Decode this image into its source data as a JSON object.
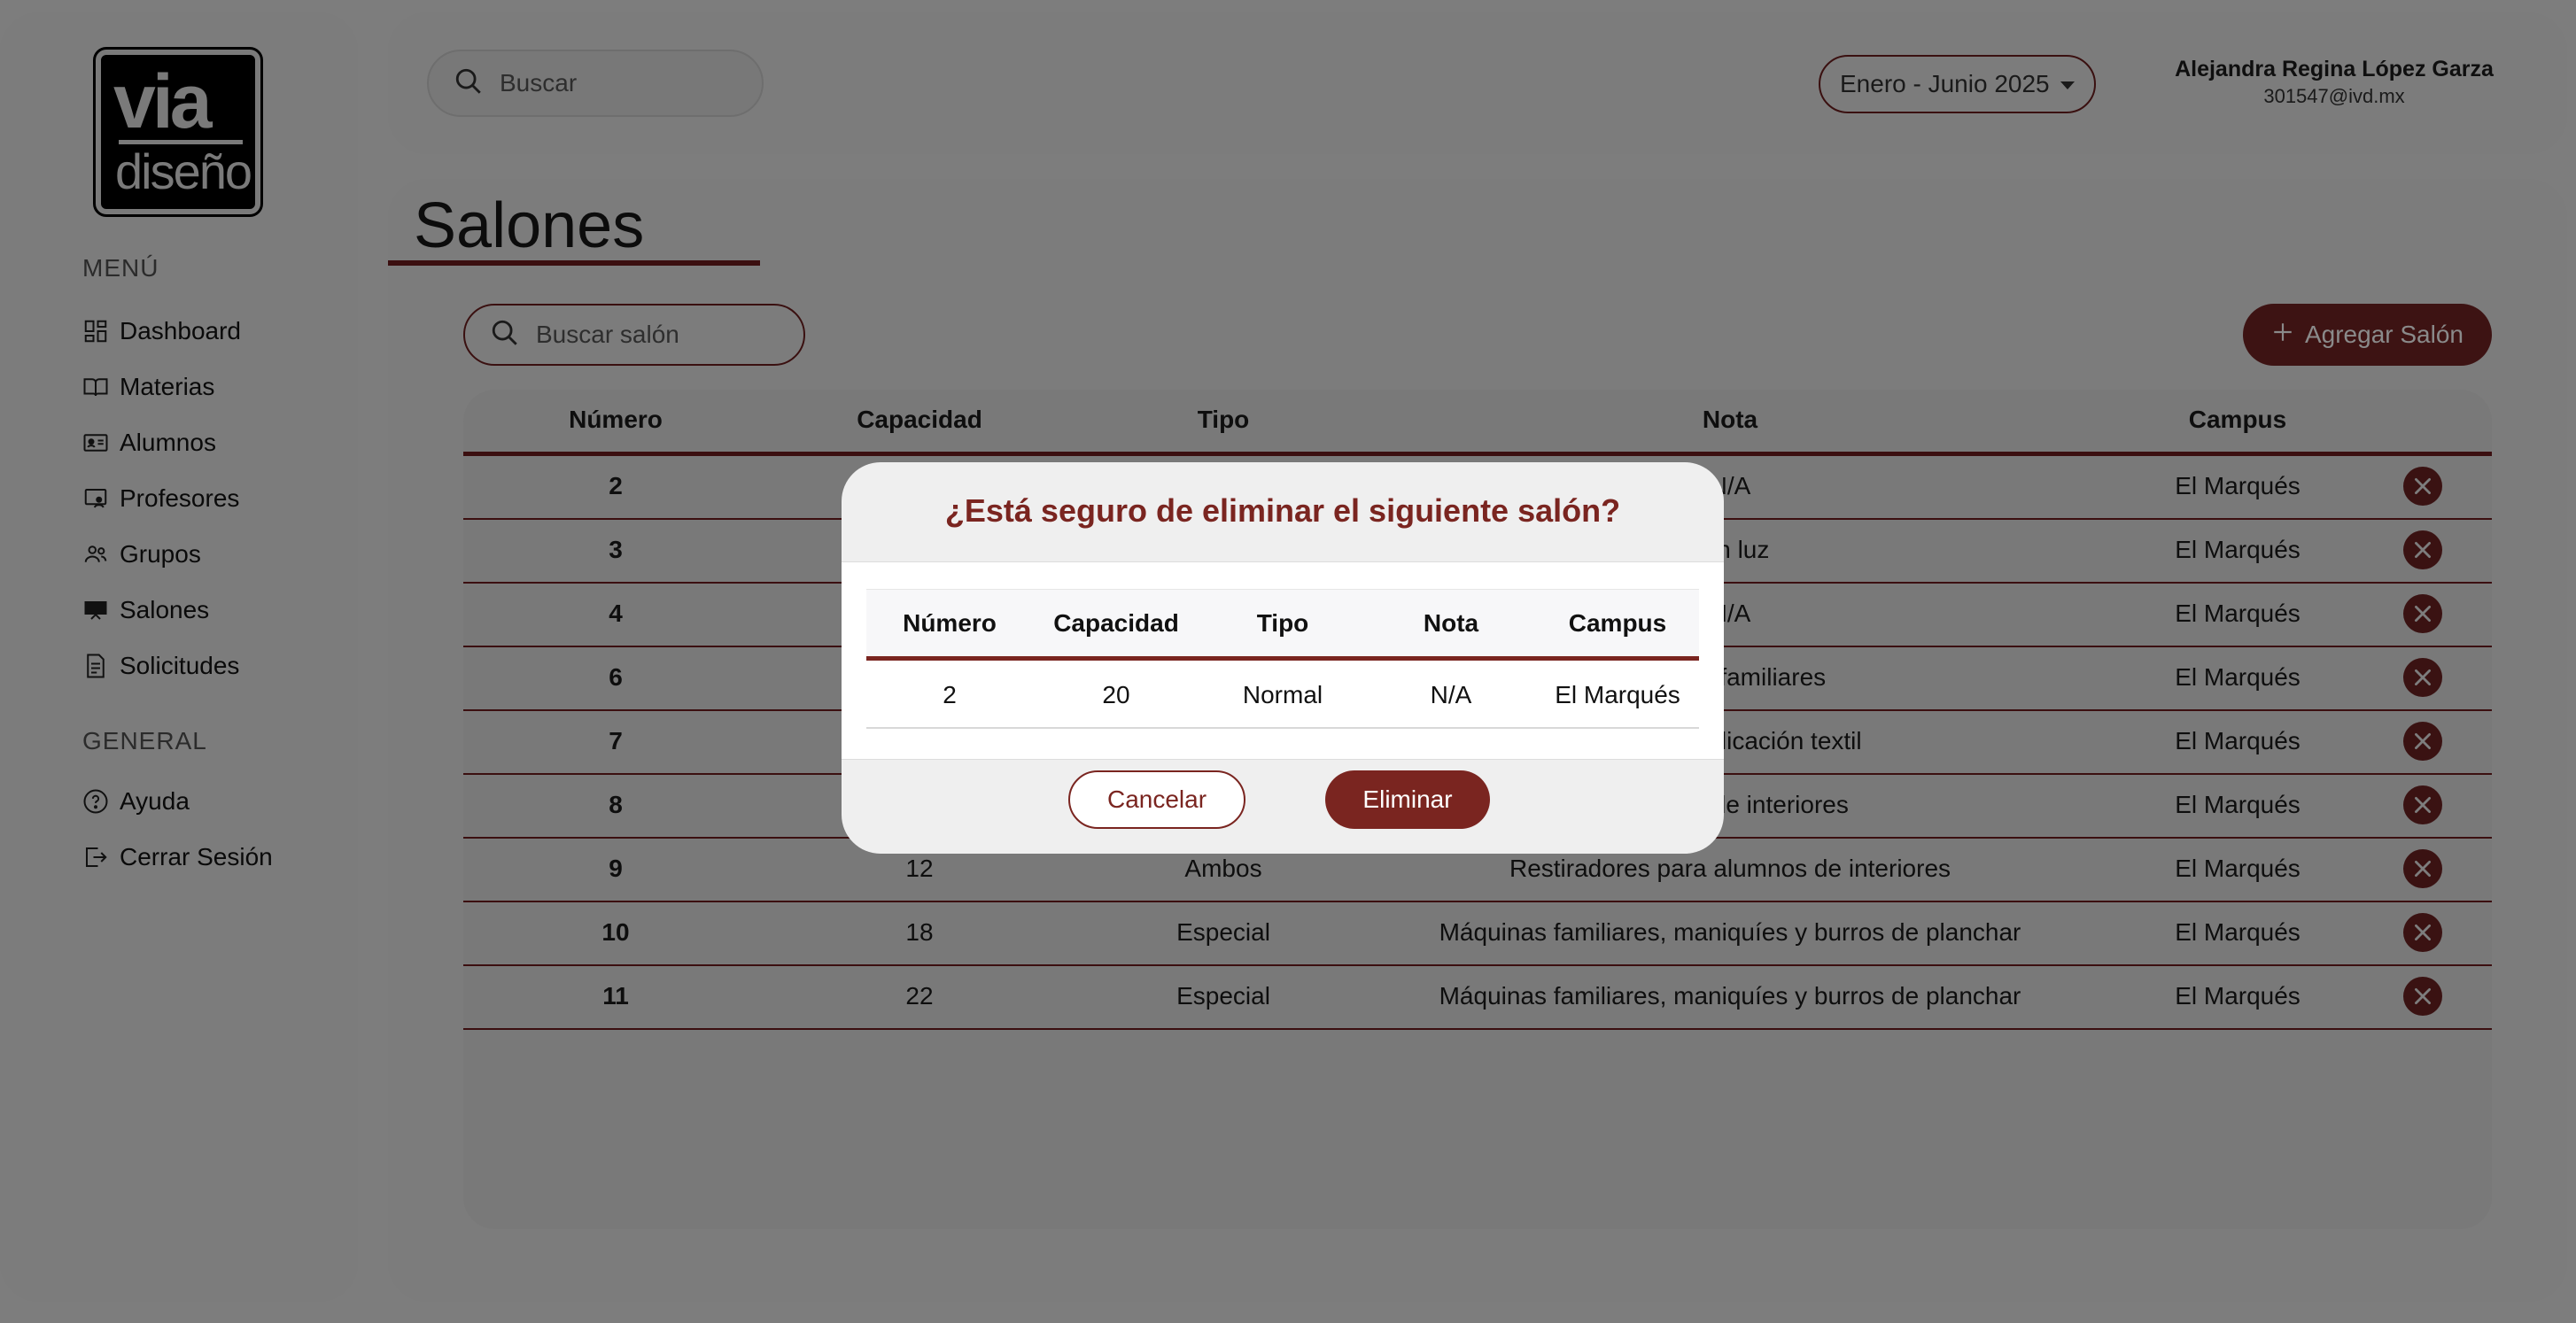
{
  "logo": {
    "line1": "via",
    "line2": "diseño"
  },
  "sidebar": {
    "menu_title": "MENÚ",
    "menu_items": [
      {
        "label": "Dashboard",
        "icon": "dashboard-icon"
      },
      {
        "label": "Materias",
        "icon": "book-icon"
      },
      {
        "label": "Alumnos",
        "icon": "id-card-icon"
      },
      {
        "label": "Profesores",
        "icon": "teacher-icon"
      },
      {
        "label": "Grupos",
        "icon": "users-icon"
      },
      {
        "label": "Salones",
        "icon": "classroom-icon"
      },
      {
        "label": "Solicitudes",
        "icon": "document-icon"
      }
    ],
    "general_title": "GENERAL",
    "general_items": [
      {
        "label": "Ayuda",
        "icon": "help-icon"
      },
      {
        "label": "Cerrar Sesión",
        "icon": "logout-icon"
      }
    ]
  },
  "header": {
    "search_placeholder": "Buscar",
    "period": "Enero - Junio 2025",
    "user_name": "Alejandra Regina López Garza",
    "user_email": "301547@ivd.mx"
  },
  "page": {
    "title": "Salones",
    "search_placeholder": "Buscar salón",
    "add_label": "Agregar Salón"
  },
  "table": {
    "columns": [
      "Número",
      "Capacidad",
      "Tipo",
      "Nota",
      "Campus"
    ],
    "rows": [
      {
        "numero": "2",
        "capacidad": "",
        "tipo": "",
        "nota": "N/A",
        "campus": "El Marqués"
      },
      {
        "numero": "3",
        "capacidad": "",
        "tipo": "",
        "nota": "con luz",
        "campus": "El Marqués"
      },
      {
        "numero": "4",
        "capacidad": "",
        "tipo": "",
        "nota": "N/A",
        "campus": "El Marqués"
      },
      {
        "numero": "6",
        "capacidad": "",
        "tipo": "",
        "nota": "riales y familiares",
        "campus": "El Marqués"
      },
      {
        "numero": "7",
        "capacidad": "",
        "tipo": "",
        "nota": "oyería y aplicación textil",
        "campus": "El Marqués"
      },
      {
        "numero": "8",
        "capacidad": "",
        "tipo": "",
        "nota": "alumnos de interiores",
        "campus": "El Marqués"
      },
      {
        "numero": "9",
        "capacidad": "12",
        "tipo": "Ambos",
        "nota": "Restiradores para alumnos de interiores",
        "campus": "El Marqués"
      },
      {
        "numero": "10",
        "capacidad": "18",
        "tipo": "Especial",
        "nota": "Máquinas familiares, maniquíes y burros de planchar",
        "campus": "El Marqués"
      },
      {
        "numero": "11",
        "capacidad": "22",
        "tipo": "Especial",
        "nota": "Máquinas familiares, maniquíes y burros de planchar",
        "campus": "El Marqués"
      }
    ]
  },
  "modal": {
    "title": "¿Está seguro de eliminar el siguiente salón?",
    "columns": [
      "Número",
      "Capacidad",
      "Tipo",
      "Nota",
      "Campus"
    ],
    "row": {
      "numero": "2",
      "capacidad": "20",
      "tipo": "Normal",
      "nota": "N/A",
      "campus": "El Marqués"
    },
    "cancel_label": "Cancelar",
    "delete_label": "Eliminar"
  },
  "colors": {
    "accent": "#7a2520",
    "overlay_dark_accent": "#3b0f10",
    "background_dimmed": "#7d7d7d"
  }
}
